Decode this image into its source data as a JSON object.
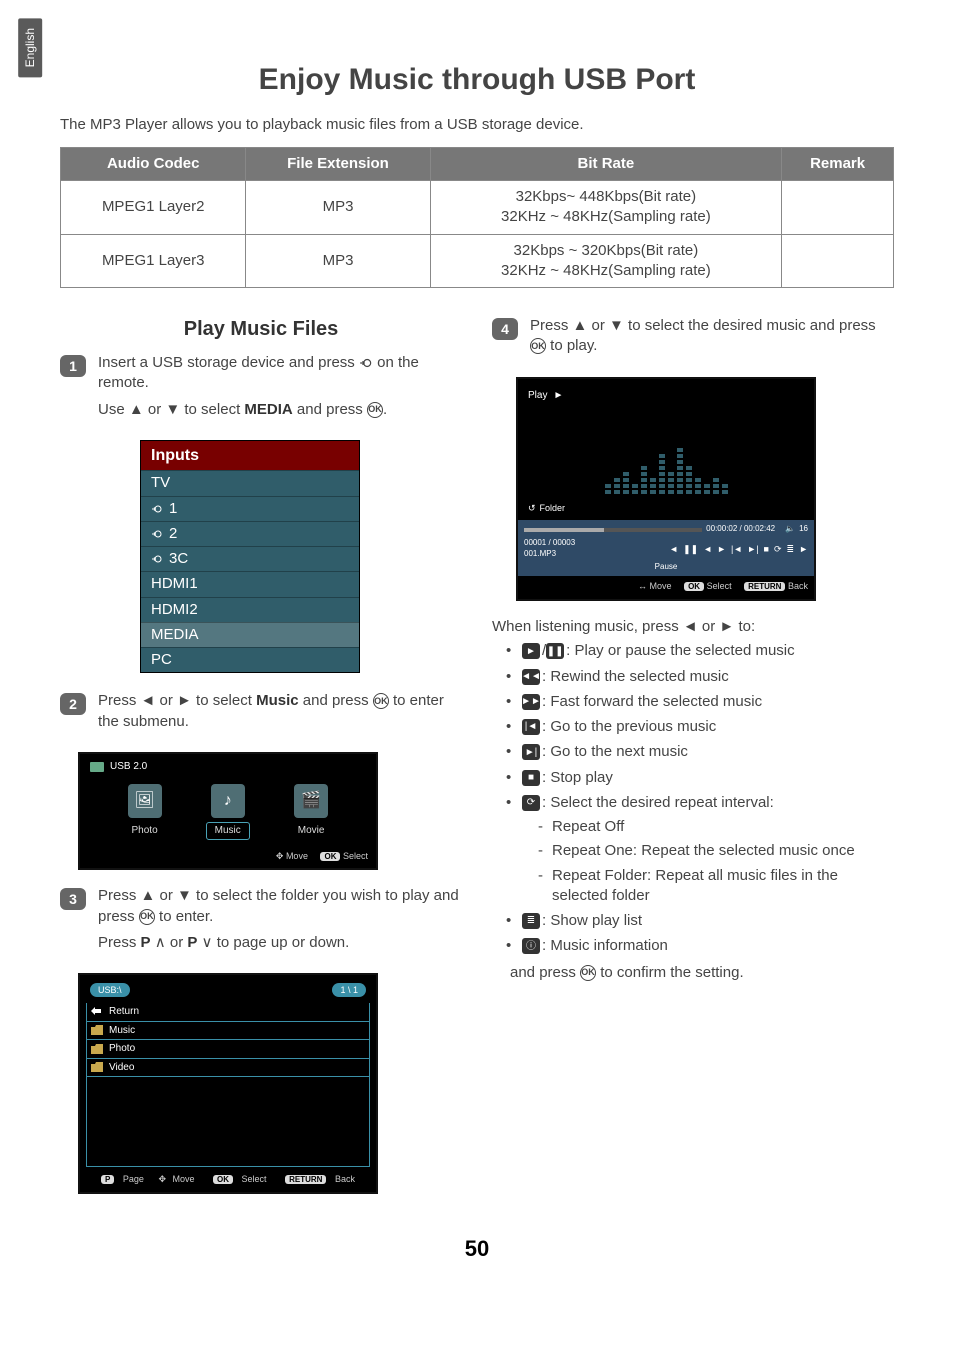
{
  "language_tab": "English",
  "title": "Enjoy Music through USB Port",
  "intro": "The MP3 Player allows you to playback music files from a USB storage device.",
  "table": {
    "headers": {
      "codec": "Audio Codec",
      "ext": "File Extension",
      "bitrate": "Bit Rate",
      "remark": "Remark"
    },
    "rows": [
      {
        "codec": "MPEG1 Layer2",
        "ext": "MP3",
        "bitrate": "32Kbps~ 448Kbps(Bit rate)\n32KHz ~ 48KHz(Sampling rate)",
        "remark": ""
      },
      {
        "codec": "MPEG1 Layer3",
        "ext": "MP3",
        "bitrate": "32Kbps ~ 320Kbps(Bit rate)\n32KHz ~ 48KHz(Sampling rate)",
        "remark": ""
      }
    ]
  },
  "section_heading": "Play Music Files",
  "steps": {
    "s1a_pre": "Insert a USB storage device and  press ",
    "s1a_post": " on the remote.",
    "s1b_pre": "Use ▲ or ▼ to select ",
    "s1b_bold": "MEDIA",
    "s1b_post": " and press ",
    "s1b_end": ".",
    "s2_pre": "Press ◄ or ► to select ",
    "s2_bold": "Music",
    "s2_mid": " and press ",
    "s2_post": " to enter the submenu.",
    "s3a_pre": "Press ▲ or ▼ to select the folder you wish to play and press ",
    "s3a_post": " to enter.",
    "s3b": "Press P ∧ or P ∨ to page up or down.",
    "s4_pre": "Press ▲ or ▼ to select the desired music and press ",
    "s4_post": " to play."
  },
  "inputs_osd": {
    "title": "Inputs",
    "items": [
      "TV",
      "1",
      "2",
      "3C",
      "HDMI1",
      "HDMI2",
      "MEDIA",
      "PC"
    ]
  },
  "media_osd": {
    "device": "USB 2.0",
    "tiles": {
      "photo": "Photo",
      "music": "Music",
      "movie": "Movie"
    },
    "hints": {
      "move": "Move",
      "select": "Select",
      "ok": "OK"
    }
  },
  "folder_osd": {
    "path": "USB:\\",
    "page": "1 \\ 1",
    "rows": [
      "Return",
      "Music",
      "Photo",
      "Video"
    ],
    "hints": {
      "page": "Page",
      "move": "Move",
      "select": "Select",
      "back": "Back",
      "p": "P",
      "ok": "OK",
      "ret": "RETURN"
    }
  },
  "play_osd": {
    "title": "Play",
    "folder": "Folder",
    "time": "00:00:02 / 00:02:42",
    "counter": "00001 / 00003",
    "file": "001.MP3",
    "vol": "16",
    "pause_label": "Pause",
    "hints": {
      "move": "Move",
      "select": "Select",
      "back": "Back",
      "ok": "OK",
      "ret": "RETURN"
    }
  },
  "listen_intro": "When listening music, press ◄ or ► to:",
  "actions": {
    "playpause": ": Play or pause the selected music",
    "rewind": ": Rewind the selected music",
    "ff": ": Fast forward the selected music",
    "prev": ": Go to the previous music",
    "next": ": Go to the next music",
    "stop": ": Stop play",
    "repeat": ": Select the desired repeat interval:",
    "repeat_off": "Repeat Off",
    "repeat_one": "Repeat One: Repeat the selected music once",
    "repeat_folder": "Repeat Folder: Repeat all music files in the selected folder",
    "playlist": ": Show play list",
    "info": ": Music information"
  },
  "confirm_pre": "and press ",
  "confirm_post": " to confirm the setting.",
  "page_number": "50",
  "glyph": {
    "ok": "OK",
    "play": "►",
    "pause": "❚❚",
    "rewind": "◄◄",
    "ff": "►►",
    "prev": "|◄",
    "next": "►|",
    "stop": "■",
    "repeat": "⟳",
    "list": "≣",
    "info": "ⓘ",
    "left": "◄",
    "right": "►",
    "up": "▲",
    "down": "▼",
    "folder": "↺",
    "speaker": "🔈"
  }
}
